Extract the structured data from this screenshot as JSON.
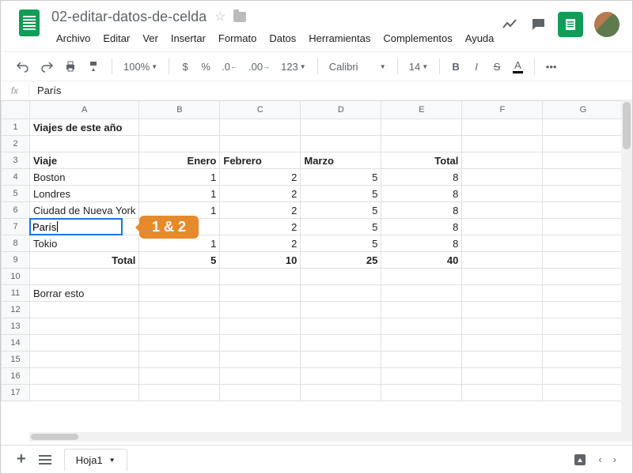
{
  "doc": {
    "title": "02-editar-datos-de-celda"
  },
  "menu": {
    "file": "Archivo",
    "edit": "Editar",
    "view": "Ver",
    "insert": "Insertar",
    "format": "Formato",
    "data": "Datos",
    "tools": "Herramientas",
    "addons": "Complementos",
    "help": "Ayuda"
  },
  "toolbar": {
    "zoom": "100%",
    "currency": "$",
    "percent": "%",
    "dec_dec": ".0",
    "dec_inc": ".00",
    "numfmt": "123",
    "font": "Calibri",
    "size": "14",
    "bold": "B",
    "italic": "I",
    "strike": "S",
    "more": "•••"
  },
  "fx": {
    "label": "fx",
    "value": "París"
  },
  "columns": [
    "A",
    "B",
    "C",
    "D",
    "E",
    "F",
    "G"
  ],
  "rows": [
    "1",
    "2",
    "3",
    "4",
    "5",
    "6",
    "7",
    "8",
    "9",
    "10",
    "11",
    "12",
    "13",
    "14",
    "15",
    "16",
    "17"
  ],
  "cells": {
    "A1": "Viajes de este año",
    "A3": "Viaje",
    "B3": "Enero",
    "C3": "Febrero",
    "D3": "Marzo",
    "E3": "Total",
    "A4": "Boston",
    "B4": "1",
    "C4": "2",
    "D4": "5",
    "E4": "8",
    "A5": "Londres",
    "B5": "1",
    "C5": "2",
    "D5": "5",
    "E5": "8",
    "A6": "Ciudad de Nueva York",
    "B6": "1",
    "C6": "2",
    "D6": "5",
    "E6": "8",
    "A7": "París",
    "C7": "2",
    "D7": "5",
    "E7": "8",
    "A8": "Tokio",
    "B8": "1",
    "C8": "2",
    "D8": "5",
    "E8": "8",
    "A9": "Total",
    "B9": "5",
    "C9": "10",
    "D9": "25",
    "E9": "40",
    "A11": "Borrar esto"
  },
  "active": {
    "value": "París"
  },
  "callout": {
    "text": "1 & 2"
  },
  "sheet": {
    "tab": "Hoja1"
  }
}
